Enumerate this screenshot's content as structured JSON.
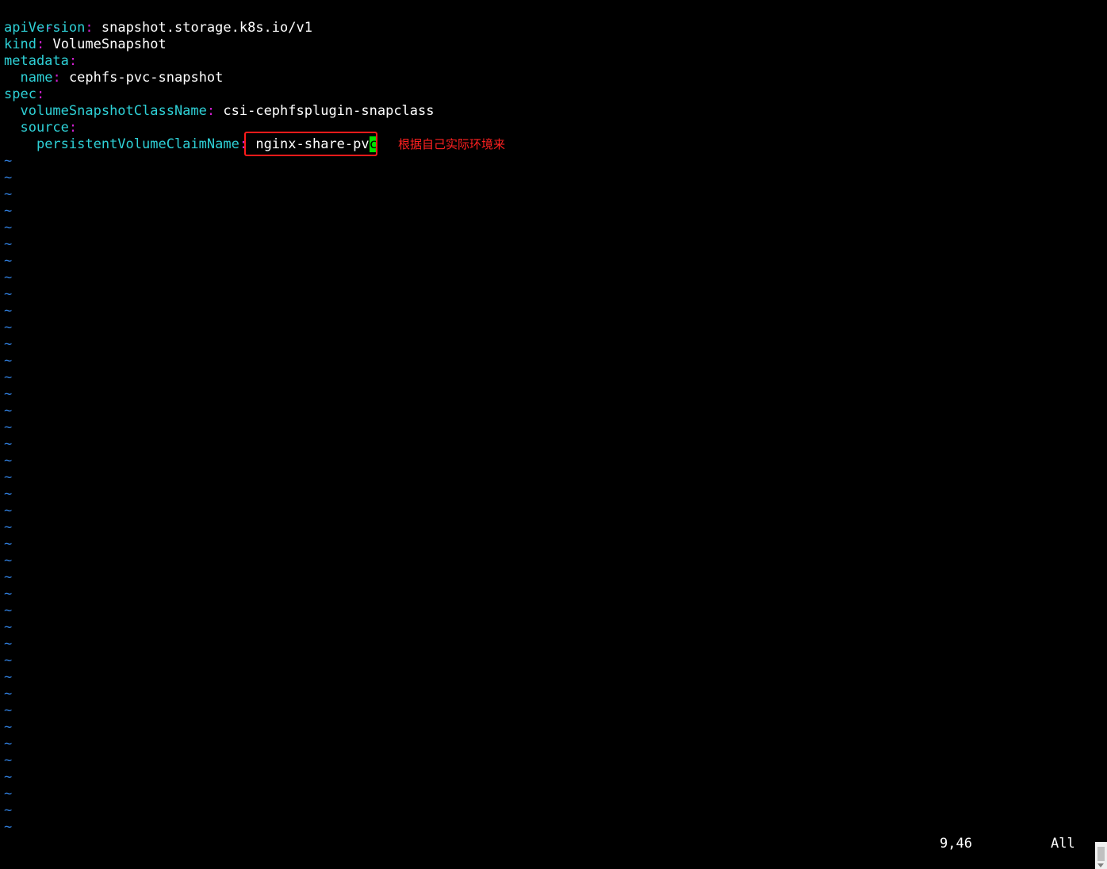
{
  "editor": {
    "doc_separator": "---",
    "lines": [
      {
        "indent": "",
        "key": "apiVersion",
        "value": "snapshot.storage.k8s.io/v1"
      },
      {
        "indent": "",
        "key": "kind",
        "value": "VolumeSnapshot"
      },
      {
        "indent": "",
        "key": "metadata",
        "value": ""
      },
      {
        "indent": "  ",
        "key": "name",
        "value": "cephfs-pvc-snapshot"
      },
      {
        "indent": "",
        "key": "spec",
        "value": ""
      },
      {
        "indent": "  ",
        "key": "volumeSnapshotClassName",
        "value": "csi-cephfsplugin-snapclass"
      },
      {
        "indent": "  ",
        "key": "source",
        "value": ""
      },
      {
        "indent": "    ",
        "key": "persistentVolumeClaimName",
        "value_before_cursor": "nginx-share-pv",
        "cursor_char": "c"
      }
    ],
    "empty_line_marker": "~",
    "empty_line_count": 41
  },
  "annotation": {
    "text": "根据自己实际环境来",
    "color": "#ff2020"
  },
  "status": {
    "position": "9,46",
    "scroll": "All"
  },
  "colors": {
    "background": "#000000",
    "key": "#2ed0d6",
    "colon": "#d11fd1",
    "tilde": "#2e7ad6",
    "cursor": "#00e000",
    "highlight_border": "#ff1a1a"
  }
}
